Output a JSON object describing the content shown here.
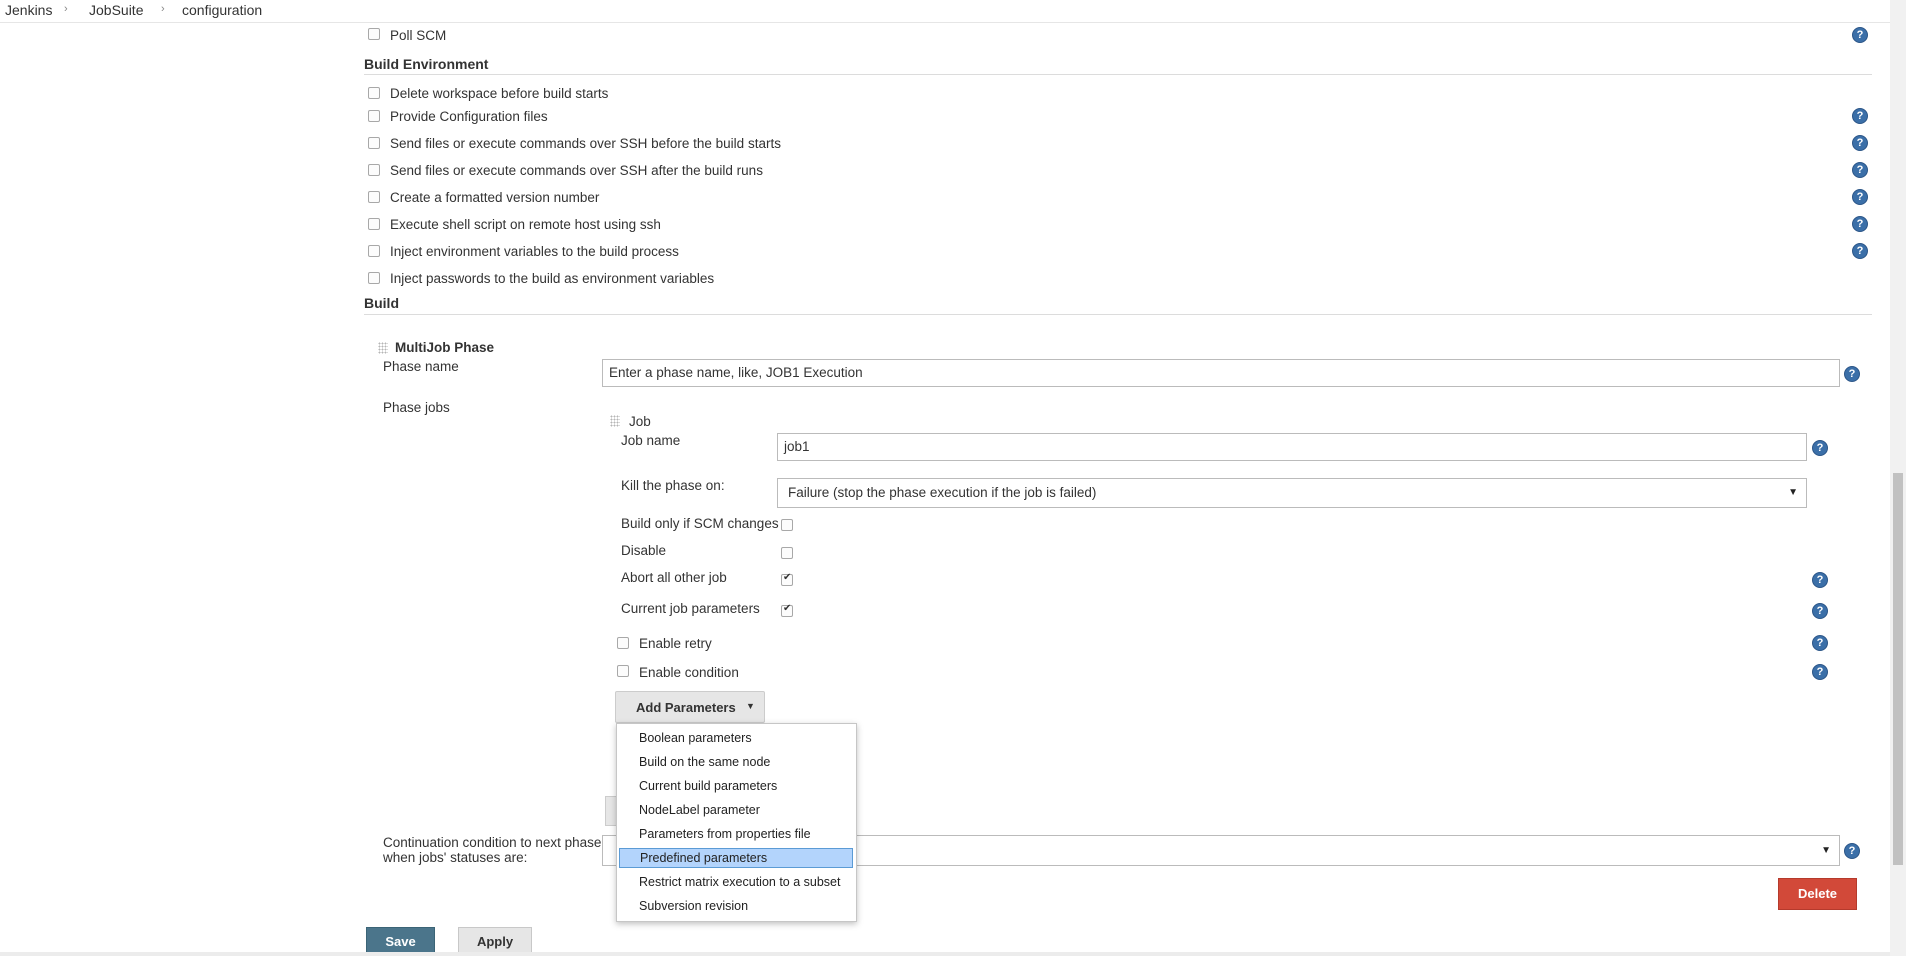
{
  "breadcrumb": [
    "Jenkins",
    "JobSuite",
    "configuration"
  ],
  "trigger": {
    "poll_scm": "Poll SCM"
  },
  "build_env": {
    "title": "Build Environment",
    "items": [
      "Delete workspace before build starts",
      "Provide Configuration files",
      "Send files or execute commands over SSH before the build starts",
      "Send files or execute commands over SSH after the build runs",
      "Create a formatted version number",
      "Execute shell script on remote host using ssh",
      "Inject environment variables to the build process",
      "Inject passwords to the build as environment variables"
    ]
  },
  "build": {
    "title": "Build",
    "phase_title": "MultiJob Phase",
    "phase_name_label": "Phase name",
    "phase_name_value": "Enter a phase name, like, JOB1 Execution",
    "phase_jobs_label": "Phase jobs",
    "job": {
      "title": "Job",
      "job_name_label": "Job name",
      "job_name_value": "job1",
      "kill_label": "Kill the phase on:",
      "kill_value": "Failure (stop the phase execution if the job is failed)",
      "build_only_scm": "Build only if SCM changes",
      "disable": "Disable",
      "abort_all": "Abort all other job",
      "current_params": "Current job parameters",
      "enable_retry": "Enable retry",
      "enable_condition": "Enable condition",
      "add_params": "Add Parameters"
    },
    "continuation_label_1": "Continuation condition to next phase",
    "continuation_label_2": "when jobs' statuses are:",
    "delete": "Delete"
  },
  "dropdown": {
    "items": [
      "Boolean parameters",
      "Build on the same node",
      "Current build parameters",
      "NodeLabel parameter",
      "Parameters from properties file",
      "Predefined parameters",
      "Restrict matrix execution to a subset",
      "Subversion revision"
    ],
    "selected": "Predefined parameters"
  },
  "footer": {
    "save": "Save",
    "apply": "Apply"
  },
  "help_glyph": "?",
  "colors": {
    "help": "#3b6fa8",
    "save": "#4b758b",
    "delete": "#d24939",
    "selection": "#b3d4fc"
  }
}
